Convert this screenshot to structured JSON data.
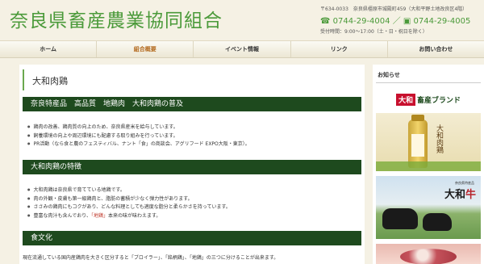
{
  "header": {
    "title": "奈良県畜産農業協同組合",
    "address": "〒634-0033　奈良県橿原市城殿町459（大和平野土地改良区4階）",
    "tel_label": "☎",
    "tel": "0744-29-4004",
    "separator": "／",
    "fax_label": "▣",
    "fax": "0744-29-4005",
    "hours": "受付時間：9:00〜17:00（土・日・祝日を除く）"
  },
  "nav": {
    "items": [
      {
        "label": "ホーム",
        "active": false
      },
      {
        "label": "組合概要",
        "active": true
      },
      {
        "label": "イベント情報",
        "active": false
      },
      {
        "label": "リンク",
        "active": false
      },
      {
        "label": "お問い合わせ",
        "active": false
      }
    ]
  },
  "main": {
    "page_heading": "大和肉鶏",
    "section1": {
      "title": "奈良特産品　高品質　地鶏肉　大和肉鶏の普及",
      "bullets": [
        "鶏肉の改善、鶏肉質の向上のため、奈良県産米を給与しています。",
        "飼養環境の向上や周辺環境にも配慮する取り組みを行っています。",
        "PR活動（なら食と農のフェスティバル、ナント「食」の商談会、アグリフード EXPO大阪・東京）。"
      ]
    },
    "section2": {
      "title": "大和肉鶏の特徴",
      "bullets": [
        "大和肉鶏は奈良県で育てている地鶏です。",
        "肉の外観・皮膚も第一級鶏肉と、脂肪の蓄積が少なく弾力性があります。",
        "ささみの鶏肉にもコクがあり、どんな料理としても適度な脂分と柔らかさを持っています。"
      ],
      "last_bullet_prefix": "豊富な肉汁も含んでおり、",
      "last_bullet_highlight": "「地鶏」",
      "last_bullet_suffix": "本来の味が味わえます。"
    },
    "section3": {
      "title": "食文化",
      "paragraph": "現在流通している国内産鶏肉を大きく区分すると「ブロイラー」、「銘柄鶏」、「地鶏」の三つに分けることが出来ます。"
    }
  },
  "sidebar": {
    "title": "お知らせ",
    "banner1": {
      "highlight": "大和",
      "rest": "畜産ブランド"
    },
    "banner2": {
      "text": "大和肉鶏"
    },
    "banner3": {
      "small": "奈良県特産品",
      "logo_prefix": "大和",
      "logo_suffix": "牛"
    }
  },
  "colors": {
    "title_green": "#4b9a3a",
    "section_bar": "#1e4a1e",
    "active_nav": "#b36a1e",
    "highlight_red": "#c0392b"
  }
}
